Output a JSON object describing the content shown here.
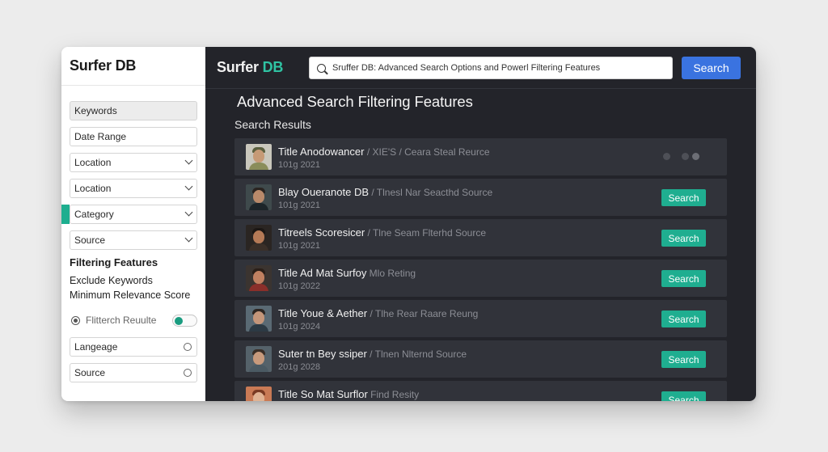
{
  "app": {
    "name": "Surfer DB",
    "logo_main": "Surfer ",
    "logo_accent": "DB"
  },
  "sidebar": {
    "title": "Surfer DB",
    "fields": {
      "keywords": "Keywords",
      "date_range": "Date Range",
      "location_1": "Location",
      "location_2": "Location",
      "category": "Category",
      "source": "Source"
    },
    "filtering_title": "Filtering Features",
    "exclude_keywords": "Exclude Keywords",
    "min_relevance": "Minimum Relevance Score",
    "toggle_label": "Flitterch Reuulte",
    "language": "Langeage",
    "source_2": "Source"
  },
  "search": {
    "query": "Sruffer DB: Advanced Search Options and Powerl Filtering Features",
    "button": "Search"
  },
  "page_title": "Advanced Search Filtering Features",
  "results_label": "Search Results",
  "results": [
    {
      "title": "Title Anodowancer",
      "sub": " / XIE'S / Ceara Steal Reurce",
      "date": "101g 2021",
      "action": ""
    },
    {
      "title": "Blay Oueranote DB",
      "sub": " / Tlnesl Nar Seacthd Source",
      "date": "101g 2021",
      "action": "Search"
    },
    {
      "title": "Titreels Scoresicer",
      "sub": " / Tlne Seam Flterhd Source",
      "date": "101g 2021",
      "action": "Search"
    },
    {
      "title": "Title Ad Mat Surfoy",
      "sub": " Mlo Reting",
      "date": "101g 2022",
      "action": "Search"
    },
    {
      "title": "Title Youe & Aether",
      "sub": " / Tlhe Rear Raare Reung",
      "date": "101g 2024",
      "action": "Search"
    },
    {
      "title": "Suter tn Bey ssiper",
      "sub": " / Tlnen Nlternd Source",
      "date": "201g 2028",
      "action": "Search"
    },
    {
      "title": "Title So Mat Surflor",
      "sub": " Find Resity",
      "date": "",
      "action": "Search"
    }
  ],
  "colors": {
    "accent": "#1fae90",
    "primary_button": "#3a73e0",
    "main_bg": "#23242a",
    "card_bg": "#31333a"
  }
}
